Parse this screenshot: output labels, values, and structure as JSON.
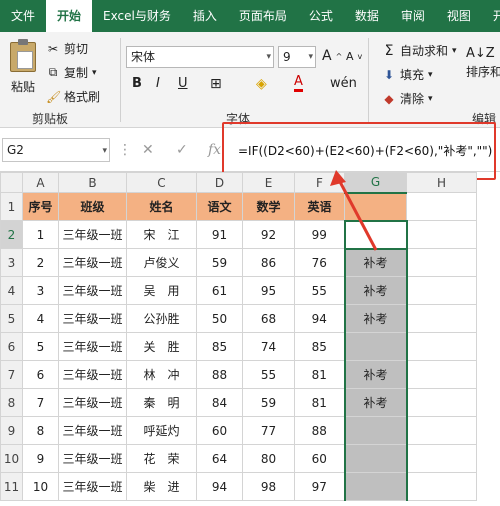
{
  "tabs": [
    "文件",
    "开始",
    "Excel与财务",
    "插入",
    "页面布局",
    "公式",
    "数据",
    "审阅",
    "视图",
    "开"
  ],
  "active_tab_index": 1,
  "clipboard": {
    "paste": "粘贴",
    "cut": "剪切",
    "copy": "复制",
    "format_painter": "格式刷",
    "group_label": "剪贴板"
  },
  "font": {
    "name": "宋体",
    "size": "9",
    "bold": "B",
    "italic": "I",
    "underline": "U",
    "font_color": "A",
    "group_label": "字体"
  },
  "editing": {
    "autosum": "自动求和",
    "fill": "填充",
    "clear": "清除",
    "sort": "排序和",
    "group_label": "编辑"
  },
  "formula_bar": {
    "name_box": "G2",
    "formula": "=IF((D2<60)+(E2<60)+(F2<60),\"补考\",\"\")"
  },
  "columns": [
    "A",
    "B",
    "C",
    "D",
    "E",
    "F",
    "G",
    "H"
  ],
  "header": [
    "序号",
    "班级",
    "姓名",
    "语文",
    "数学",
    "英语",
    ""
  ],
  "rows": [
    [
      "1",
      "三年级一班",
      "宋　江",
      "91",
      "92",
      "99",
      ""
    ],
    [
      "2",
      "三年级一班",
      "卢俊义",
      "59",
      "86",
      "76",
      "补考"
    ],
    [
      "3",
      "三年级一班",
      "吴　用",
      "61",
      "95",
      "55",
      "补考"
    ],
    [
      "4",
      "三年级一班",
      "公孙胜",
      "50",
      "68",
      "94",
      "补考"
    ],
    [
      "5",
      "三年级一班",
      "关　胜",
      "85",
      "74",
      "85",
      ""
    ],
    [
      "6",
      "三年级一班",
      "林　冲",
      "88",
      "55",
      "81",
      "补考"
    ],
    [
      "7",
      "三年级一班",
      "秦　明",
      "84",
      "59",
      "81",
      "补考"
    ],
    [
      "8",
      "三年级一班",
      "呼延灼",
      "60",
      "77",
      "88",
      ""
    ],
    [
      "9",
      "三年级一班",
      "花　荣",
      "64",
      "80",
      "60",
      ""
    ],
    [
      "10",
      "三年级一班",
      "柴　进",
      "94",
      "98",
      "97",
      ""
    ]
  ],
  "row_numbers": [
    "1",
    "2",
    "3",
    "4",
    "5",
    "6",
    "7",
    "8",
    "9",
    "10",
    "11"
  ],
  "colors": {
    "ribbon": "#217346",
    "header_fill": "#f4b183",
    "highlight": "#e0392b"
  }
}
